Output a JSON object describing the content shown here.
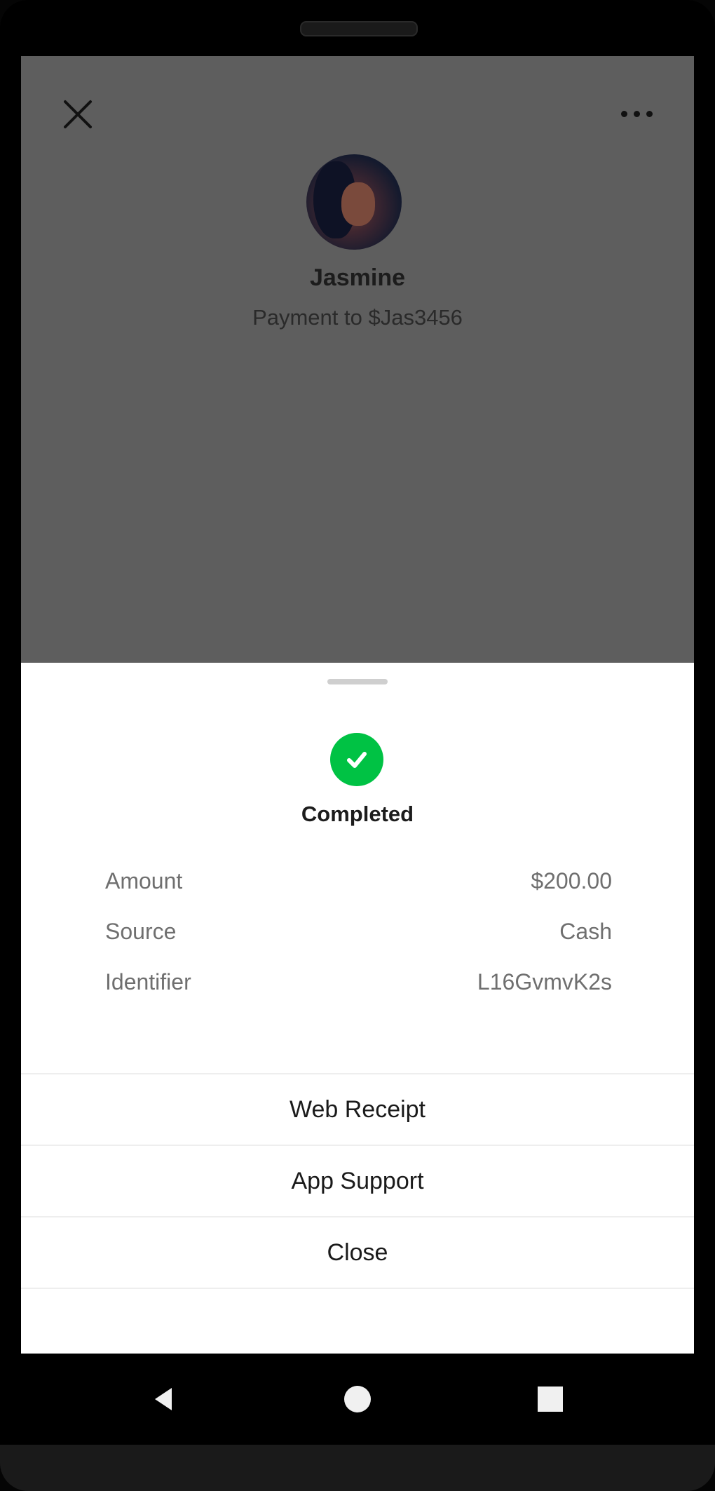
{
  "header": {
    "close_icon": "close-icon",
    "more_icon": "more-options-icon"
  },
  "contact": {
    "name": "Jasmine",
    "subtitle": "Payment to $Jas3456",
    "avatar_icon": "avatar"
  },
  "status": {
    "icon": "check-circle-icon",
    "label": "Completed",
    "color": "#00c244"
  },
  "details": [
    {
      "label": "Amount",
      "value": "$200.00"
    },
    {
      "label": "Source",
      "value": "Cash"
    },
    {
      "label": "Identifier",
      "value": "L16GvmvK2s"
    }
  ],
  "actions": {
    "web_receipt": "Web Receipt",
    "app_support": "App Support",
    "close": "Close"
  },
  "system_nav": {
    "back_icon": "back-icon",
    "home_icon": "home-icon",
    "recents_icon": "recents-icon"
  }
}
